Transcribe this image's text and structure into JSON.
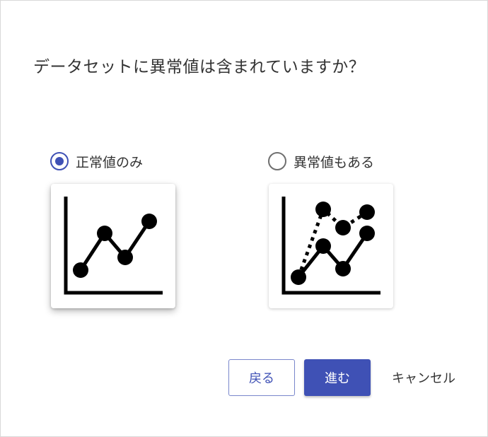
{
  "dialog": {
    "question": "データセットに異常値は含まれていますか？",
    "options": [
      {
        "label": "正常値のみ",
        "selected": true,
        "icon": "line-chart-icon"
      },
      {
        "label": "異常値もある",
        "selected": false,
        "icon": "line-chart-with-outliers-icon"
      }
    ],
    "buttons": {
      "back": "戻る",
      "next": "進む",
      "cancel": "キャンセル"
    }
  },
  "colors": {
    "accent": "#3f51b5",
    "text": "#333333",
    "radio_unselected": "#6f6f6f"
  }
}
